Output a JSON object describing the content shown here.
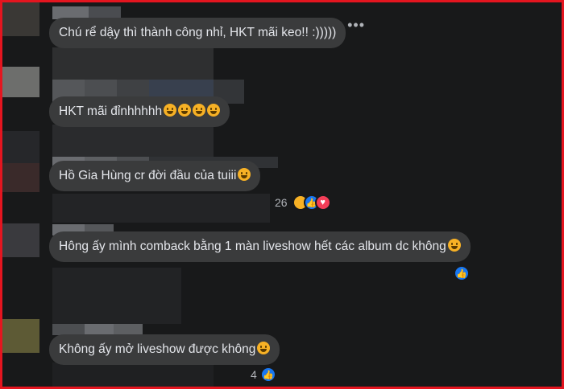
{
  "comments": [
    {
      "text": "Chú rể dậy thì thành công nhỉ, HKT mãi keo!! :)))))",
      "emojis": []
    },
    {
      "text": "HKT mãi đỉnhhhhh",
      "emojis": [
        "laughing-face-icon",
        "laughing-face-icon",
        "laughing-face-icon",
        "laughing-face-icon"
      ]
    },
    {
      "text": "Hồ Gia Hùng cr đời đầu của tuiii",
      "emojis": [
        "crying-face-icon"
      ],
      "reaction_count": "26"
    },
    {
      "text": "Hông ấy mình comback bằng 1 màn liveshow hết các album dc không",
      "emojis": [
        "laughing-tears-icon"
      ]
    },
    {
      "text": "Không ấy mở liveshow được không",
      "emojis": [
        "pleading-face-icon"
      ],
      "reaction_count": "4"
    }
  ],
  "more_menu": "•••",
  "colors": {
    "frame": "#e4151f",
    "bubble": "#3a3b3c",
    "like": "#1877f2",
    "love": "#f33e58"
  }
}
